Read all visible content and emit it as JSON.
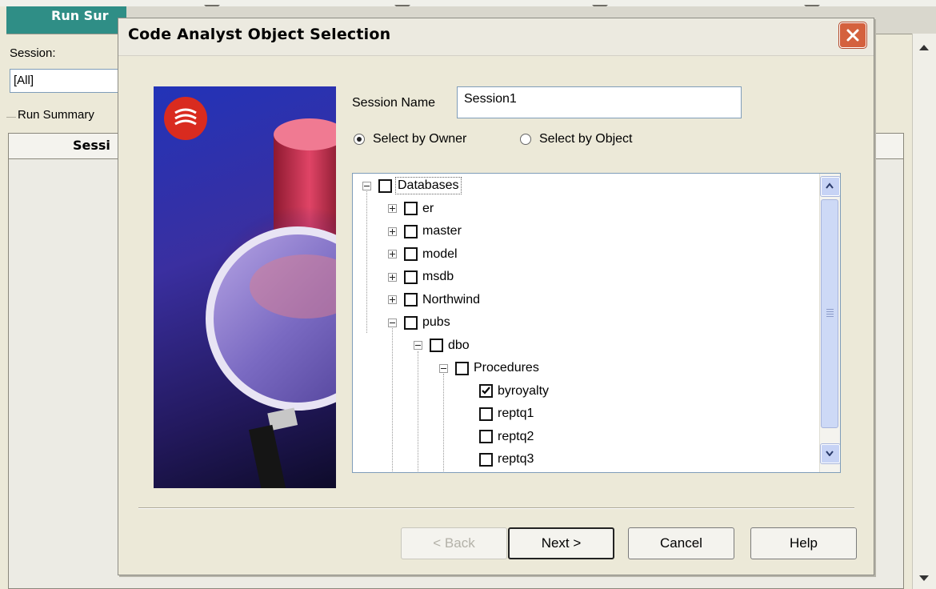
{
  "background": {
    "tab_label": "Run Sur",
    "session_label": "Session:",
    "session_value": "[All]",
    "group_label": "Run Summary",
    "grid_header": "Sessi"
  },
  "dialog": {
    "title": "Code Analyst Object Selection",
    "session_name_label": "Session Name",
    "session_name_value": "Session1",
    "radio_owner": "Select by Owner",
    "radio_object": "Select by Object",
    "selected_mode": "owner",
    "tree": [
      {
        "label": "Databases",
        "level": 0,
        "expander": "minus",
        "checked": false
      },
      {
        "label": "er",
        "level": 1,
        "expander": "plus",
        "checked": false
      },
      {
        "label": "master",
        "level": 1,
        "expander": "plus",
        "checked": false
      },
      {
        "label": "model",
        "level": 1,
        "expander": "plus",
        "checked": false
      },
      {
        "label": "msdb",
        "level": 1,
        "expander": "plus",
        "checked": false
      },
      {
        "label": "Northwind",
        "level": 1,
        "expander": "plus",
        "checked": false
      },
      {
        "label": "pubs",
        "level": 1,
        "expander": "minus",
        "checked": false
      },
      {
        "label": "dbo",
        "level": 2,
        "expander": "minus",
        "checked": false
      },
      {
        "label": "Procedures",
        "level": 3,
        "expander": "minus",
        "checked": false
      },
      {
        "label": "byroyalty",
        "level": 4,
        "expander": "none",
        "checked": true
      },
      {
        "label": "reptq1",
        "level": 4,
        "expander": "none",
        "checked": false
      },
      {
        "label": "reptq2",
        "level": 4,
        "expander": "none",
        "checked": false
      },
      {
        "label": "reptq3",
        "level": 4,
        "expander": "none",
        "checked": false
      }
    ],
    "buttons": {
      "back": "< Back",
      "next": "Next >",
      "cancel": "Cancel",
      "help": "Help"
    }
  }
}
